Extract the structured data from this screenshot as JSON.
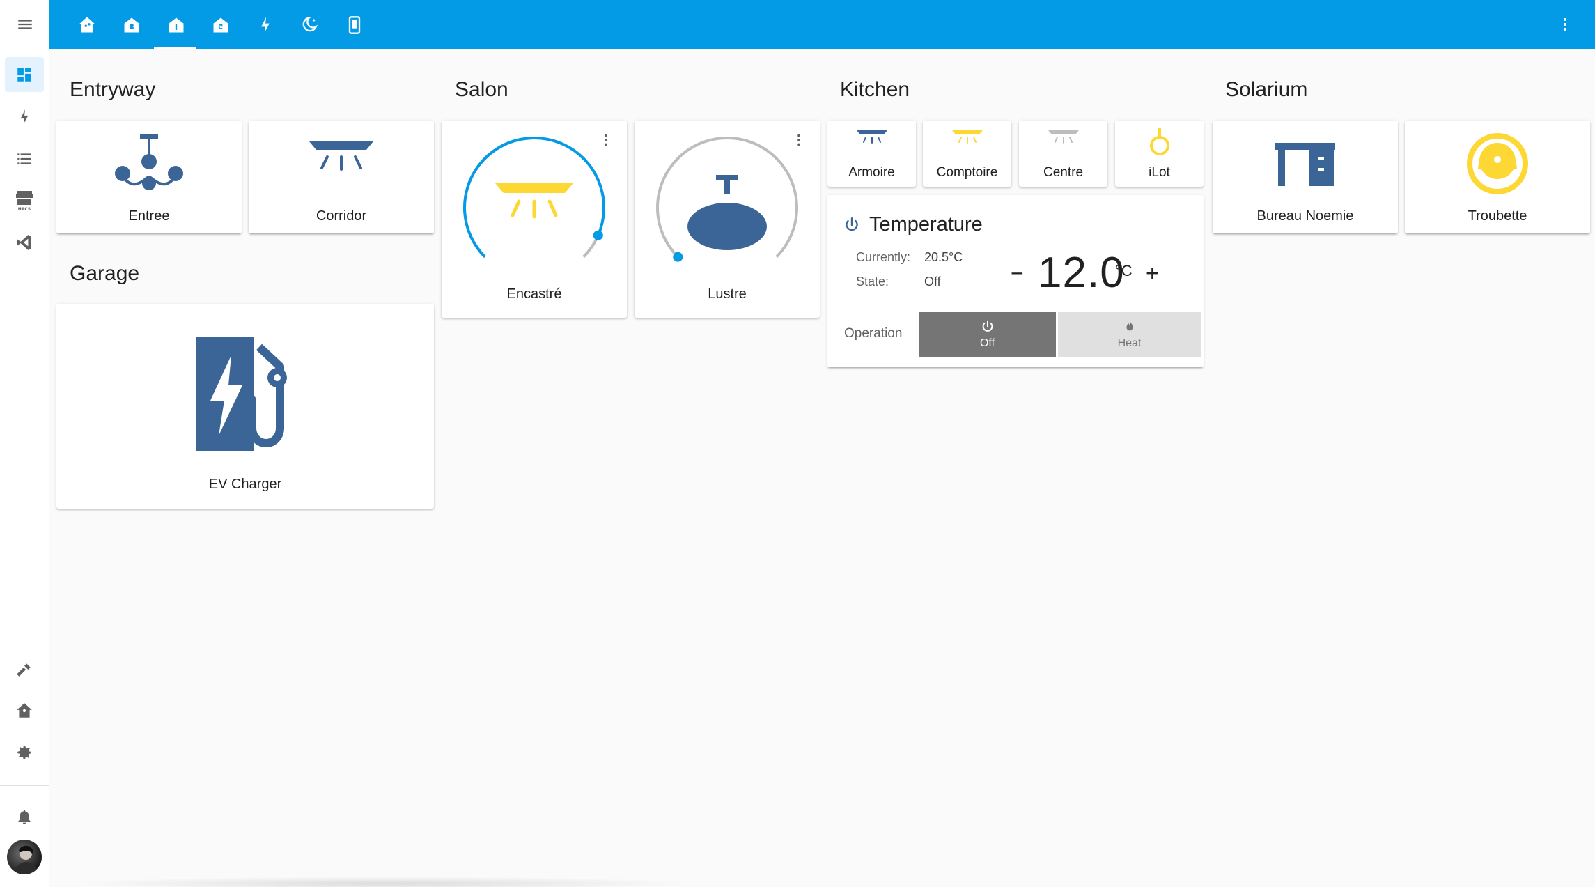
{
  "topbar": {
    "tabs": [
      {
        "name": "home-assistant-icon",
        "active": false
      },
      {
        "name": "floor-b-icon",
        "active": false
      },
      {
        "name": "floor-1-icon",
        "active": true
      },
      {
        "name": "floor-2-icon",
        "active": false
      },
      {
        "name": "lightning-icon",
        "active": false
      },
      {
        "name": "weather-night-icon",
        "active": false
      },
      {
        "name": "tablet-icon",
        "active": false
      }
    ],
    "accent_color": "#039be5"
  },
  "sidebar": {
    "items": [
      "dashboard-icon",
      "energy-icon",
      "logbook-icon",
      "hacs-icon",
      "vscode-icon",
      "developer-tools-icon",
      "supervisor-icon",
      "settings-icon",
      "notifications-icon"
    ],
    "hacs_label": "HACS"
  },
  "sections": {
    "entryway": "Entryway",
    "garage": "Garage",
    "salon": "Salon",
    "kitchen": "Kitchen",
    "solarium": "Solarium"
  },
  "cards": {
    "entree": "Entree",
    "corridor": "Corridor",
    "ev_charger": "EV Charger",
    "encastre": "Encastré",
    "lustre": "Lustre",
    "armoire": "Armoire",
    "comptoire": "Comptoire",
    "centre": "Centre",
    "ilot": "iLot",
    "bureau_noemie": "Bureau Noemie",
    "troubette": "Troubette"
  },
  "dials": {
    "encastre_level": 0.92,
    "lustre_level": 0.0
  },
  "thermostat": {
    "title": "Temperature",
    "currently_label": "Currently:",
    "currently_value": "20.5°C",
    "state_label": "State:",
    "state_value": "Off",
    "target": "12.0",
    "unit": "°C",
    "minus": "−",
    "plus": "+",
    "operation_label": "Operation",
    "off_label": "Off",
    "heat_label": "Heat"
  },
  "colors": {
    "icon_blue": "#3c6597",
    "light_yellow": "#fdd835",
    "dial_blue": "#039be5",
    "dial_grey": "#bdbdbd",
    "icon_grey": "#bdbdbd"
  }
}
